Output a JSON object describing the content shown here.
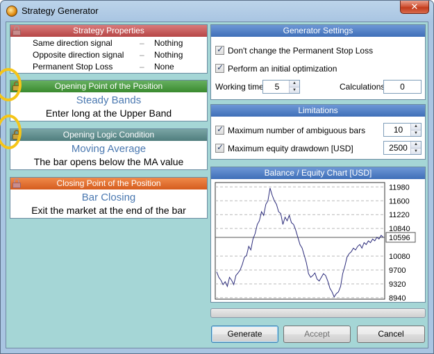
{
  "window": {
    "title": "Strategy Generator",
    "close_label": "✕"
  },
  "strategy_properties": {
    "header": "Strategy Properties",
    "rows": [
      {
        "label": "Same direction signal",
        "dash": "–",
        "value": "Nothing"
      },
      {
        "label": "Opposite direction signal",
        "dash": "–",
        "value": "Nothing"
      },
      {
        "label": "Permanent Stop Loss",
        "dash": "–",
        "value": "None"
      }
    ]
  },
  "opening_point": {
    "header": "Opening Point of the Position",
    "title": "Steady Bands",
    "description": "Enter long at the Upper Band"
  },
  "opening_logic": {
    "header": "Opening Logic Condition",
    "title": "Moving Average",
    "description": "The bar opens below the MA value"
  },
  "closing_point": {
    "header": "Closing Point of the Position",
    "title": "Bar Closing",
    "description": "Exit the market at the end of the bar"
  },
  "generator_settings": {
    "header": "Generator Settings",
    "dont_change_stop_loss": "Don't change the Permanent Stop Loss",
    "initial_optimization": "Perform an initial optimization",
    "working_time_label": "Working time",
    "working_time_value": "5",
    "calculations_label": "Calculations",
    "calculations_value": "0"
  },
  "limitations": {
    "header": "Limitations",
    "ambiguous_label": "Maximum number of ambiguous bars",
    "ambiguous_value": "10",
    "drawdown_label": "Maximum equity drawdown [USD]",
    "drawdown_value": "2500"
  },
  "chart_data": {
    "type": "line",
    "title": "Balance / Equity Chart [USD]",
    "y_ticks": [
      "11980",
      "11600",
      "11220",
      "10840",
      "10596",
      "10080",
      "9700",
      "9320",
      "8940"
    ],
    "current_value": "10596",
    "ylim": [
      8900,
      12100
    ],
    "grid": true,
    "series": [
      {
        "values": [
          9650,
          9500,
          9420,
          9300,
          9380,
          9250,
          9500,
          9420,
          9300,
          9550,
          9620,
          9700,
          9850,
          10050,
          10100,
          10350,
          10250,
          10550,
          10700,
          10950,
          11050,
          11300,
          11200,
          11500,
          11600,
          11950,
          11750,
          11600,
          11500,
          11300,
          11250,
          10950,
          11150,
          11050,
          11200,
          11000,
          10950,
          10800,
          10600,
          10400,
          10300,
          10100,
          9900,
          9600,
          9500,
          9550,
          9620,
          9450,
          9400,
          9500,
          9600,
          9550,
          9400,
          9200,
          9100,
          8960,
          9050,
          9100,
          9250,
          9600,
          9800,
          10050,
          10150,
          10200,
          10300,
          10250,
          10350,
          10400,
          10300,
          10450,
          10400,
          10500,
          10450,
          10550,
          10500,
          10600,
          10550,
          10650,
          10596
        ]
      }
    ]
  },
  "buttons": {
    "generate": "Generate",
    "accept": "Accept",
    "cancel": "Cancel"
  },
  "colors": {
    "accent_blue": "#4a78b0",
    "client_bg": "#a5d6d6",
    "highlight": "#f5c518"
  }
}
